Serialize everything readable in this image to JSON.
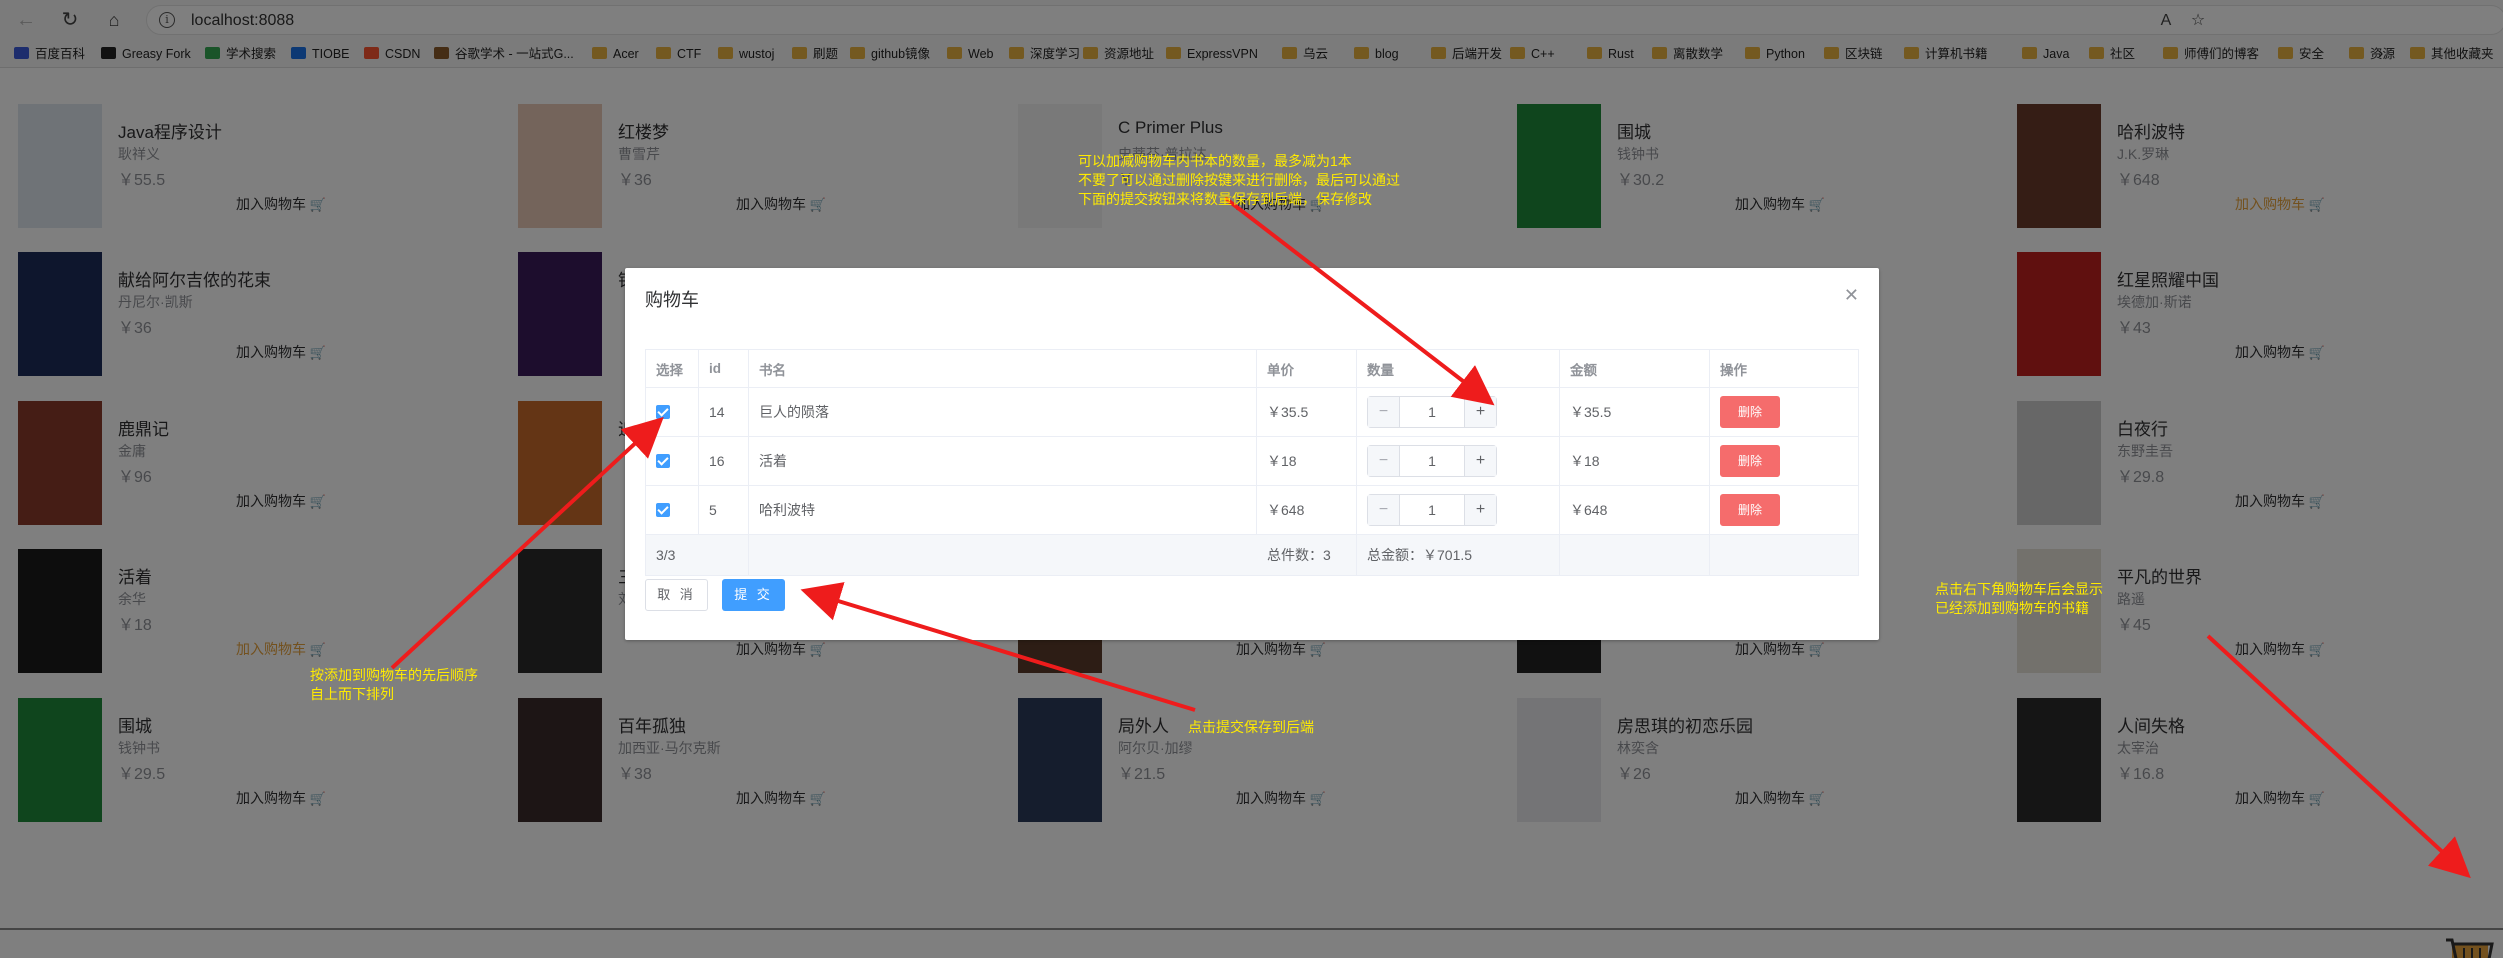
{
  "browser": {
    "url": "localhost:8088",
    "bookmarks": [
      {
        "label": "百度百科",
        "color": "#3b5bdb"
      },
      {
        "label": "Greasy Fork",
        "color": "#222222"
      },
      {
        "label": "学术搜索",
        "color": "#34a853"
      },
      {
        "label": "TIOBE",
        "color": "#1a73e8"
      },
      {
        "label": "CSDN",
        "color": "#fc5531"
      },
      {
        "label": "谷歌学术 - 一站式G...",
        "color": "#8b5a2b"
      },
      {
        "label": "Acer",
        "color": "#e9b340"
      },
      {
        "label": "CTF",
        "color": "#e9b340"
      },
      {
        "label": "wustoj",
        "color": "#e9b340"
      },
      {
        "label": "刷题",
        "color": "#e9b340"
      },
      {
        "label": "github镜像",
        "color": "#e9b340"
      },
      {
        "label": "Web",
        "color": "#e9b340"
      },
      {
        "label": "深度学习",
        "color": "#e9b340"
      },
      {
        "label": "资源地址",
        "color": "#e9b340"
      },
      {
        "label": "ExpressVPN",
        "color": "#e9b340"
      },
      {
        "label": "乌云",
        "color": "#e9b340"
      },
      {
        "label": "blog",
        "color": "#e9b340"
      },
      {
        "label": "后端开发",
        "color": "#e9b340"
      },
      {
        "label": "C++",
        "color": "#e9b340"
      },
      {
        "label": "Rust",
        "color": "#e9b340"
      },
      {
        "label": "离散数学",
        "color": "#e9b340"
      },
      {
        "label": "Python",
        "color": "#e9b340"
      },
      {
        "label": "区块链",
        "color": "#e9b340"
      },
      {
        "label": "计算机书籍",
        "color": "#e9b340"
      },
      {
        "label": "Java",
        "color": "#e9b340"
      },
      {
        "label": "社区",
        "color": "#e9b340"
      },
      {
        "label": "师傅们的博客",
        "color": "#e9b340"
      },
      {
        "label": "安全",
        "color": "#e9b340"
      },
      {
        "label": "资源",
        "color": "#e9b340"
      }
    ],
    "other_bookmarks": "其他收藏夹",
    "more_icon": "chevron-right-icon"
  },
  "shop": {
    "add_label": "加入购物车",
    "books": [
      {
        "title": "Java程序设计",
        "author": "耿祥义",
        "price": "￥55.5",
        "cover": "#dfe6ef",
        "highlight": false
      },
      {
        "title": "红楼梦",
        "author": "曹雪芹",
        "price": "￥36",
        "cover": "#e9c8b6",
        "highlight": false
      },
      {
        "title": "C Primer Plus",
        "author": "史蒂芬·普拉达",
        "price": "￥",
        "cover": "#f2f2f2",
        "highlight": false
      },
      {
        "title": "围城",
        "author": "钱钟书",
        "price": "￥30.2",
        "cover": "#1f8a3a",
        "highlight": false
      },
      {
        "title": "哈利波特",
        "author": "J.K.罗琳",
        "price": "￥648",
        "cover": "#6b3a2a",
        "highlight": true
      },
      {
        "title": "献给阿尔吉侬的花束",
        "author": "丹尼尔·凯斯",
        "price": "￥36",
        "cover": "#1d2c5a",
        "highlight": false
      },
      {
        "title": "银河帝国",
        "author": "",
        "price": "",
        "cover": "#3a1a5a",
        "highlight": false
      },
      {
        "title": "",
        "author": "",
        "price": "",
        "cover": "#ffffff",
        "highlight": false
      },
      {
        "title": "",
        "author": "",
        "price": "",
        "cover": "#ffffff",
        "highlight": false
      },
      {
        "title": "红星照耀中国",
        "author": "埃德加·斯诺",
        "price": "￥43",
        "cover": "#c0201e",
        "highlight": false
      },
      {
        "title": "鹿鼎记",
        "author": "金庸",
        "price": "￥96",
        "cover": "#8a3a2a",
        "highlight": false
      },
      {
        "title": "追风筝的人",
        "author": "",
        "price": "",
        "cover": "#c86a2a",
        "highlight": false
      },
      {
        "title": "",
        "author": "",
        "price": "",
        "cover": "#ffffff",
        "highlight": false
      },
      {
        "title": "",
        "author": "",
        "price": "",
        "cover": "#ffffff",
        "highlight": false
      },
      {
        "title": "白夜行",
        "author": "东野圭吾",
        "price": "￥29.8",
        "cover": "#cfcfcf",
        "highlight": false
      },
      {
        "title": "活着",
        "author": "余华",
        "price": "￥18",
        "cover": "#1a1a1a",
        "highlight": true
      },
      {
        "title": "三体",
        "author": "刘慈欣",
        "price": "",
        "cover": "#2a2a2a",
        "highlight": false
      },
      {
        "title": "",
        "author": "",
        "price": "",
        "cover": "#5a3a2a",
        "highlight": false
      },
      {
        "title": "",
        "author": "",
        "price": "",
        "cover": "#222222",
        "highlight": false
      },
      {
        "title": "平凡的世界",
        "author": "路遥",
        "price": "￥45",
        "cover": "#e7e2d8",
        "highlight": false
      },
      {
        "title": "围城",
        "author": "钱钟书",
        "price": "￥29.5",
        "cover": "#1f8a3a",
        "highlight": false
      },
      {
        "title": "百年孤独",
        "author": "加西亚·马尔克斯",
        "price": "￥38",
        "cover": "#3a2a2a",
        "highlight": false
      },
      {
        "title": "局外人",
        "author": "阿尔贝·加缪",
        "price": "￥21.5",
        "cover": "#2a3a5a",
        "highlight": false
      },
      {
        "title": "房思琪的初恋乐园",
        "author": "林奕含",
        "price": "￥26",
        "cover": "#e8e8ec",
        "highlight": false
      },
      {
        "title": "人间失格",
        "author": "太宰治",
        "price": "￥16.8",
        "cover": "#2a2a2a",
        "highlight": false
      }
    ]
  },
  "dialog": {
    "title": "购物车",
    "close_icon": "close-icon",
    "columns": [
      "选择",
      "id",
      "书名",
      "单价",
      "数量",
      "金额",
      "操作"
    ],
    "rows": [
      {
        "id": "14",
        "name": "巨人的陨落",
        "price": "￥35.5",
        "qty": "1",
        "amount": "￥35.5"
      },
      {
        "id": "16",
        "name": "活着",
        "price": "￥18",
        "qty": "1",
        "amount": "￥18"
      },
      {
        "id": "5",
        "name": "哈利波特",
        "price": "￥648",
        "qty": "1",
        "amount": "￥648"
      }
    ],
    "minus": "−",
    "plus": "+",
    "delete_label": "删除",
    "footer": {
      "selected": "3/3",
      "total_count": "总件数：3",
      "total_amount": "总金额：￥701.5"
    },
    "cancel_label": "取 消",
    "submit_label": "提 交"
  },
  "annotations": {
    "quantity_note": [
      "可以加减购物车内书本的数量，最多减为1本",
      "不要了可以通过删除按键来进行删除，最后可以通过",
      "下面的提交按钮来将数量保存到后端，保存修改"
    ],
    "order_note": [
      "按添加到购物车的先后顺序",
      "自上而下排列"
    ],
    "submit_note": "点击提交保存到后端",
    "cart_note": [
      "点击右下角购物车后会显示",
      "已经添加到购物车的书籍"
    ],
    "text_color": "#ffeb00",
    "arrow_color": "#ee1c1c"
  },
  "colors": {
    "primary": "#409eff",
    "danger": "#f56c6c",
    "warning": "#e6a23c"
  }
}
